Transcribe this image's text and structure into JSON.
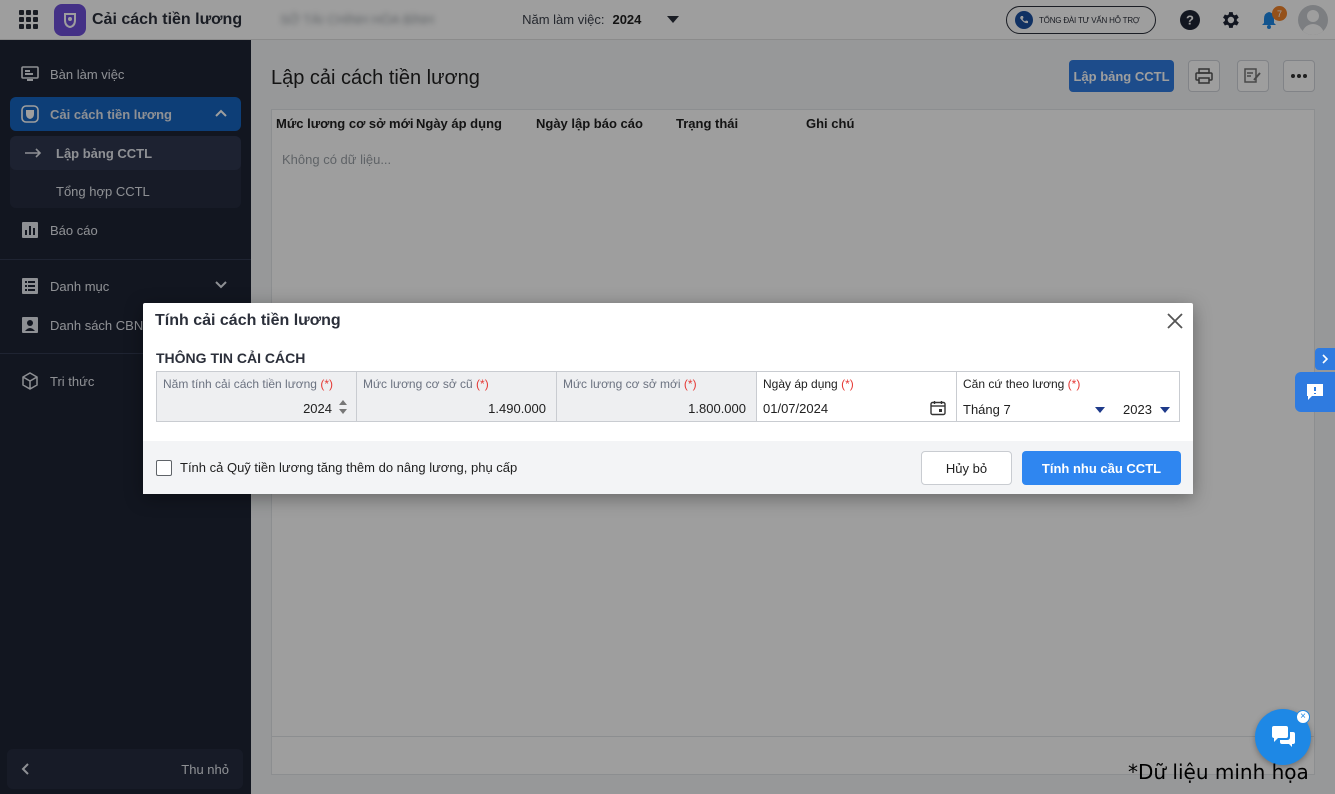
{
  "topbar": {
    "app_name": "Cải cách tiền lương",
    "org_name": "SỞ TÀI CHÍNH HÒA BÌNH",
    "year_label": "Năm làm việc:",
    "year_value": "2024",
    "hotline": "TỔNG ĐÀI TƯ VẤN HỖ TRỢ",
    "notification_count": "7"
  },
  "sidebar": {
    "items": [
      {
        "label": "Bàn làm việc"
      },
      {
        "label": "Cải cách tiền lương"
      },
      {
        "label": "Báo cáo"
      },
      {
        "label": "Danh mục"
      },
      {
        "label": "Danh sách CBNV"
      },
      {
        "label": "Tri thức"
      }
    ],
    "sub_items": [
      {
        "label": "Lập bảng CCTL"
      },
      {
        "label": "Tổng hợp CCTL"
      }
    ],
    "collapse_label": "Thu nhỏ"
  },
  "main": {
    "title": "Lập cải cách tiền lương",
    "primary_button": "Lập bảng CCTL",
    "columns": [
      "Mức lương cơ sở mới",
      "Ngày áp dụng",
      "Ngày lập báo cáo",
      "Trạng thái",
      "Ghi chú"
    ],
    "empty_text": "Không có dữ liệu..."
  },
  "dialog": {
    "title": "Tính cải cách tiền lương",
    "section_title": "THÔNG TIN CẢI CÁCH",
    "required_mark": "(*)",
    "fields": {
      "year": {
        "label": "Năm tính cải cách tiền lương",
        "value": "2024"
      },
      "old_base": {
        "label": "Mức lương cơ sở cũ",
        "value": "1.490.000"
      },
      "new_base": {
        "label": "Mức lương cơ sở mới",
        "value": "1.800.000"
      },
      "apply_date": {
        "label": "Ngày áp dụng",
        "value": "01/07/2024"
      },
      "based_on": {
        "label": "Căn cứ theo lương",
        "month": "Tháng 7",
        "year": "2023"
      }
    },
    "checkbox_label": "Tính cả Quỹ tiền lương tăng thêm do nâng lương, phụ cấp",
    "cancel_label": "Hủy bỏ",
    "submit_label": "Tính nhu cầu CCTL"
  },
  "watermark": "*Dữ liệu minh họa",
  "colors": {
    "primary": "#2f86f0",
    "sidebar_bg": "#1e2435",
    "sidebar_active": "#1565c0",
    "required": "#e53935"
  }
}
